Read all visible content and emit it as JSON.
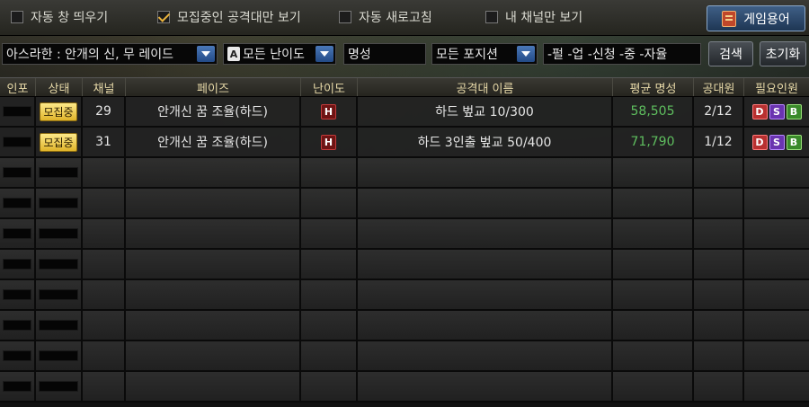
{
  "options": {
    "auto_popup": "자동 창 띄우기",
    "recruit_only": "모집중인 공격대만 보기",
    "auto_refresh": "자동 새로고침",
    "my_channel_only": "내 채널만 보기",
    "recruit_only_checked": true
  },
  "game_terms_button": "게임용어",
  "filters": {
    "raid_select": "아스라한 : 안개의 신, 무 레이드",
    "difficulty_icon_letter": "A",
    "difficulty_select": "모든 난이도",
    "fame_input": "명성",
    "position_select": "모든 포지션",
    "keyword_input": "-펄 -업 -신청 -중 -자율",
    "search_button": "검색",
    "reset_button": "초기화"
  },
  "table": {
    "headers": [
      "인포",
      "상태",
      "채널",
      "페이즈",
      "난이도",
      "공격대 이름",
      "평균 명성",
      "공대원",
      "필요인원"
    ],
    "rows": [
      {
        "status": "모집중",
        "channel": "29",
        "phase": "안개신 꿈 조율(하드)",
        "difficulty": "H",
        "name": "하드 벞교 10/300",
        "fame": "58,505",
        "members": "2/12",
        "need": [
          "D",
          "S",
          "B"
        ]
      },
      {
        "status": "모집중",
        "channel": "31",
        "phase": "안개신 꿈 조율(하드)",
        "difficulty": "H",
        "name": "하드 3인출 벞교 50/400",
        "fame": "71,790",
        "members": "1/12",
        "need": [
          "D",
          "S",
          "B"
        ]
      }
    ],
    "empty_rows": 8
  }
}
